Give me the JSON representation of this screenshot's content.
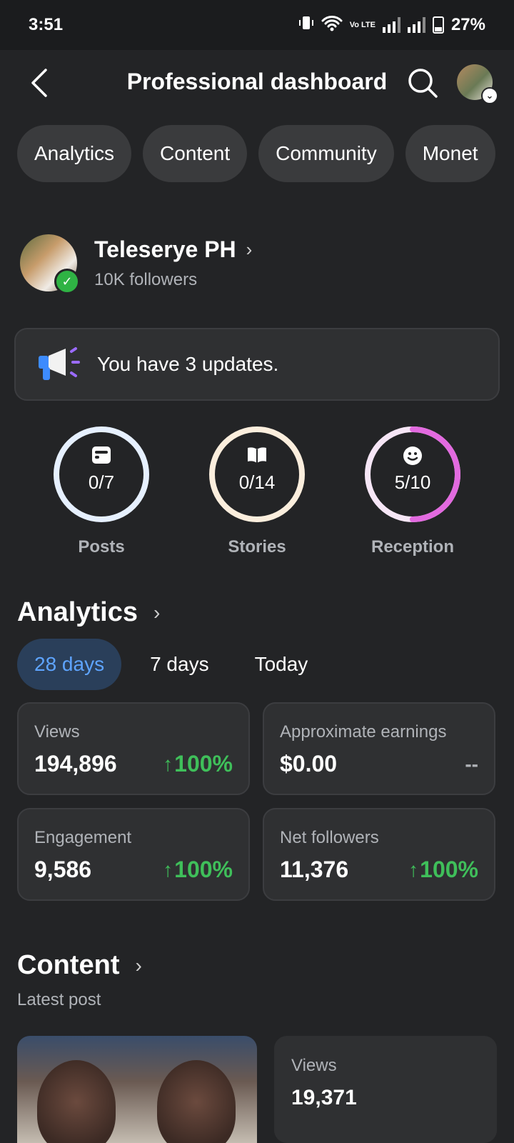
{
  "status_bar": {
    "time": "3:51",
    "volte": "Vo LTE",
    "battery": "27%"
  },
  "header": {
    "title": "Professional dashboard"
  },
  "tabs": [
    "Analytics",
    "Content",
    "Community",
    "Monet"
  ],
  "page": {
    "name": "Teleserye PH",
    "followers": "10K followers"
  },
  "updates": {
    "text": "You have 3 updates."
  },
  "rings": [
    {
      "label": "Posts",
      "value": "0/7",
      "progress": 0,
      "color": "#e6f0ff"
    },
    {
      "label": "Stories",
      "value": "0/14",
      "progress": 0,
      "color": "#fbeedd"
    },
    {
      "label": "Reception",
      "value": "5/10",
      "progress": 0.5,
      "color": "#e26adf"
    }
  ],
  "analytics": {
    "title": "Analytics",
    "ranges": [
      "28 days",
      "7 days",
      "Today"
    ],
    "metrics": [
      {
        "label": "Views",
        "value": "194,896",
        "change": "100%"
      },
      {
        "label": "Approximate earnings",
        "value": "$0.00",
        "change": "--"
      },
      {
        "label": "Engagement",
        "value": "9,586",
        "change": "100%"
      },
      {
        "label": "Net followers",
        "value": "11,376",
        "change": "100%"
      }
    ]
  },
  "content": {
    "title": "Content",
    "subtitle": "Latest post",
    "post_views_label": "Views",
    "post_views_value": "19,371"
  },
  "colors": {
    "background": "#232426",
    "card": "#2f3032",
    "accent_blue": "#5ea4ff",
    "positive_green": "#3fbf5a"
  }
}
